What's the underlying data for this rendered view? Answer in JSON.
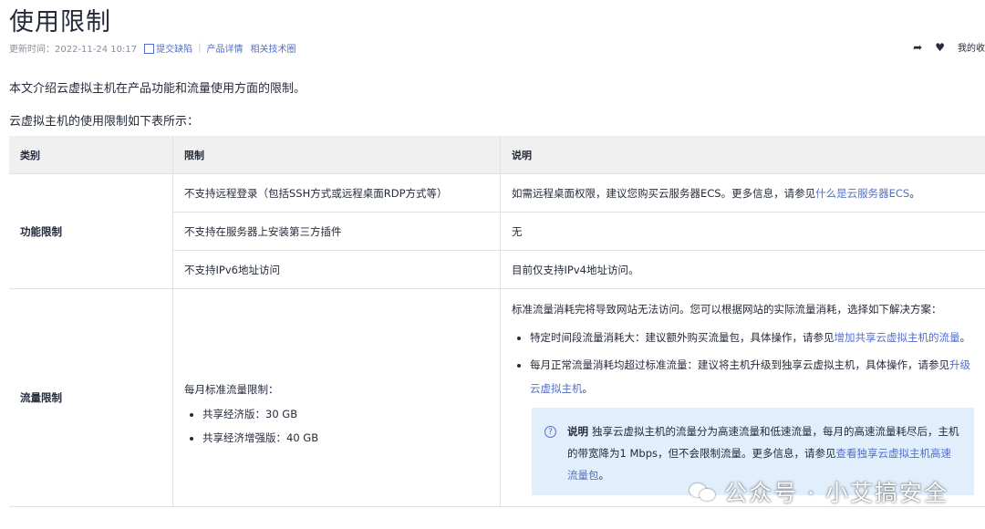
{
  "page": {
    "title": "使用限制",
    "updated": "更新时间：2022-11-24 10:17",
    "submit_bug": "提交缺陷",
    "product_details": "产品详情",
    "related_forum": "相关技术圈",
    "favorites": "我的收",
    "intro": "本文介绍云虚拟主机在产品功能和流量使用方面的限制。",
    "intro2": "云虚拟主机的使用限制如下表所示："
  },
  "icons": {
    "share": "share-icon",
    "like": "heart-icon",
    "edit": "edit-icon",
    "help": "question-icon",
    "wechat": "wechat-icon"
  },
  "table": {
    "headers": [
      "类别",
      "限制",
      "说明"
    ],
    "func": {
      "category": "功能限制",
      "rows": [
        {
          "limit": "不支持远程登录（包括SSH方式或远程桌面RDP方式等）",
          "desc_prefix": "如需远程桌面权限，建议您购买云服务器ECS。更多信息，请参见",
          "desc_link": "什么是云服务器ECS",
          "desc_suffix": "。"
        },
        {
          "limit": "不支持在服务器上安装第三方插件",
          "desc": "无"
        },
        {
          "limit": "不支持IPv6地址访问",
          "desc": "目前仅支持IPv4地址访问。"
        }
      ]
    },
    "traffic": {
      "category": "流量限制",
      "limit_title": "每月标准流量限制：",
      "limit_items": [
        "共享经济版：30 GB",
        "共享经济增强版：40 GB"
      ],
      "desc_intro": "标准流量消耗完将导致网站无法访问。您可以根据网站的实际流量消耗，选择如下解决方案：",
      "bullets": [
        {
          "text": "特定时间段流量消耗大：建议额外购买流量包，具体操作，请参见",
          "link": "增加共享云虚拟主机的流量",
          "suffix": "。"
        },
        {
          "text": "每月正常流量消耗均超过标准流量：建议将主机升级到独享云虚拟主机，具体操作，请参见",
          "link": "升级云虚拟主机",
          "suffix": "。"
        }
      ],
      "note": {
        "label": "说明",
        "text": "独享云虚拟主机的流量分为高速流量和低速流量，每月的高速流量耗尽后，主机的带宽降为1 Mbps，但不会限制流量。更多信息，请参见",
        "link": "查看独享云虚拟主机高速流量包",
        "suffix": "。"
      }
    }
  },
  "watermark": "公众号 · 小艾搞安全"
}
